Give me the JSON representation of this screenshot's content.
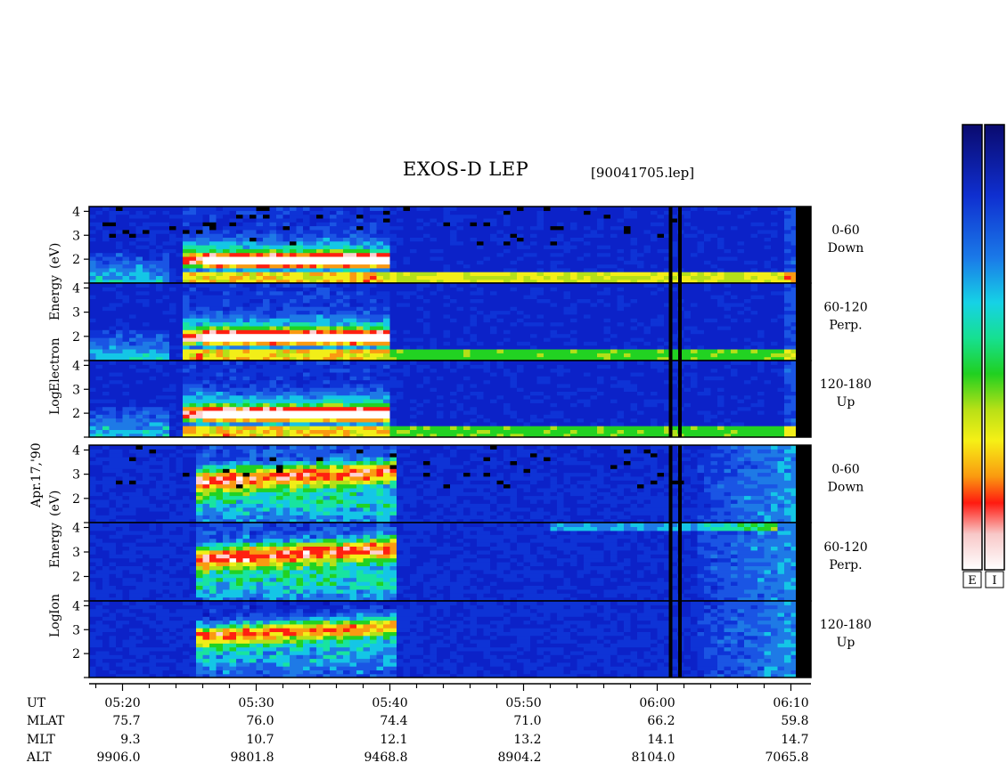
{
  "header": {
    "title": "EXOS-D LEP",
    "file": "[90041705.lep]"
  },
  "y_axis": {
    "electron_label": [
      "Log",
      "Electron",
      "Energy",
      "(eV)"
    ],
    "ion_label": [
      "Log",
      "Ion",
      "Energy",
      "(eV)"
    ],
    "date_label": "Apr.17,'90",
    "ticks": [
      "4",
      "3",
      "2"
    ],
    "ticks_bottom": [
      "3",
      "2"
    ]
  },
  "panels": [
    {
      "species": "electron",
      "range": "0-60",
      "dir": "Down"
    },
    {
      "species": "electron",
      "range": "60-120",
      "dir": "Perp."
    },
    {
      "species": "electron",
      "range": "120-180",
      "dir": "Up"
    },
    {
      "species": "ion",
      "range": "0-60",
      "dir": "Down"
    },
    {
      "species": "ion",
      "range": "60-120",
      "dir": "Perp."
    },
    {
      "species": "ion",
      "range": "120-180",
      "dir": "Up"
    }
  ],
  "colorbar": {
    "labels": [
      "E",
      "I"
    ],
    "colors": [
      "#0a0a6e",
      "#0f2fd0",
      "#1a7ae8",
      "#16d2e6",
      "#16e090",
      "#20d020",
      "#b8e016",
      "#f6f016",
      "#fa9a10",
      "#ff1a10",
      "#f8c8c8",
      "#ffffff"
    ]
  },
  "chart_data": {
    "type": "heatmap",
    "title": "EXOS-D LEP",
    "xlabel": "UT",
    "ylabel": "Log Energy (eV)",
    "x_ticks": [
      "05:20",
      "05:30",
      "05:40",
      "05:50",
      "06:00",
      "06:10"
    ],
    "x_minutes": [
      20,
      30,
      40,
      50,
      60,
      70
    ],
    "xlim_minutes": [
      17.5,
      71.5
    ],
    "ylim": [
      1,
      4.2
    ],
    "ephemeris": [
      {
        "name": "MLAT",
        "values": [
          "75.7",
          "76.0",
          "74.4",
          "71.0",
          "66.2",
          "59.8"
        ]
      },
      {
        "name": "MLT",
        "values": [
          "9.3",
          "10.7",
          "12.1",
          "13.2",
          "14.1",
          "14.7"
        ]
      },
      {
        "name": "ALT",
        "values": [
          "9906.0",
          "9801.8",
          "9468.8",
          "8904.2",
          "8104.0",
          "7065.8"
        ]
      }
    ],
    "data_gaps_minutes": [
      61.0,
      61.7
    ]
  }
}
